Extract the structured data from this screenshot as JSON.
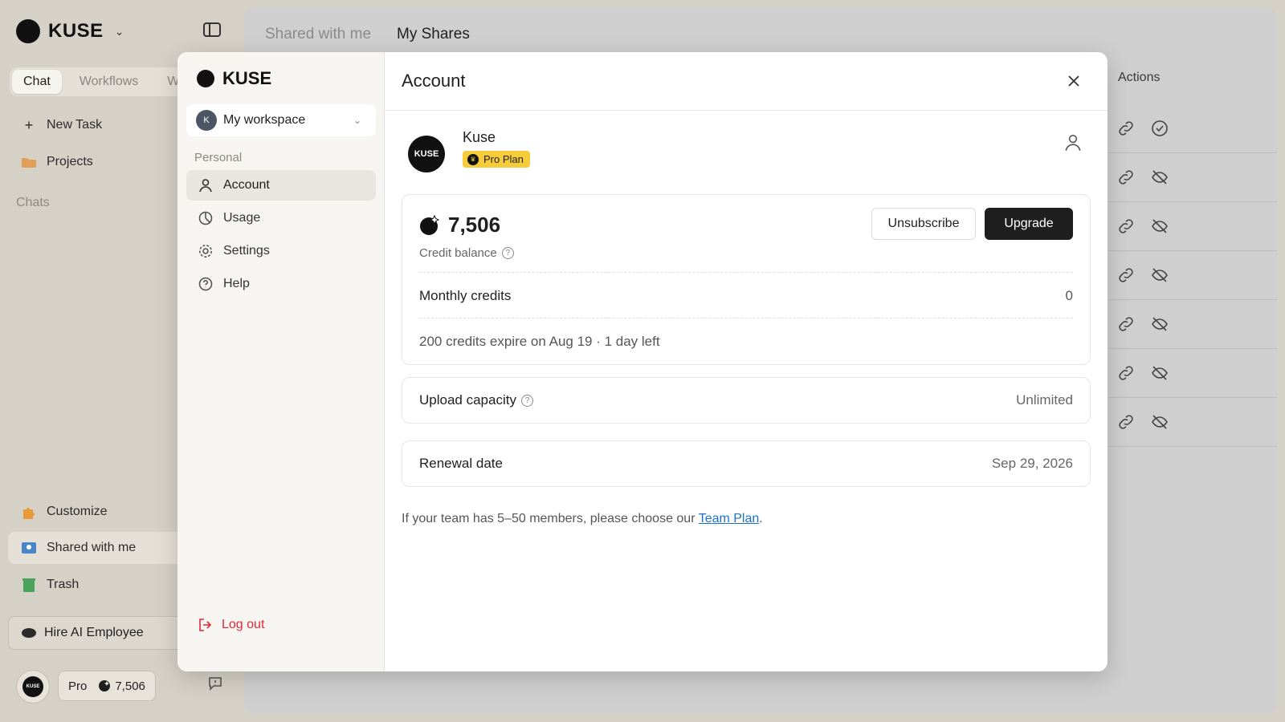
{
  "app": {
    "brand": "KUSE",
    "segment_tabs": [
      "Chat",
      "Workflows",
      "W"
    ],
    "nav": {
      "new_task": "New Task",
      "projects": "Projects",
      "chats_label": "Chats",
      "customize": "Customize",
      "shared_with_me": "Shared with me",
      "trash": "Trash",
      "hire": "Hire AI Employee"
    },
    "footer": {
      "avatar_text": "KUSE",
      "plan": "Pro",
      "credits": "7,506"
    },
    "main_tabs": [
      "Shared with me",
      "My Shares"
    ],
    "actions_header": "Actions",
    "action_rows": [
      {
        "first_icon": "link-icon",
        "second_icon": "check-circle-icon"
      },
      {
        "first_icon": "link-icon",
        "second_icon": "eye-off-icon"
      },
      {
        "first_icon": "link-icon",
        "second_icon": "eye-off-icon"
      },
      {
        "first_icon": "link-icon",
        "second_icon": "eye-off-icon"
      },
      {
        "first_icon": "link-icon",
        "second_icon": "eye-off-icon"
      },
      {
        "first_icon": "link-icon",
        "second_icon": "eye-off-icon"
      },
      {
        "first_icon": "link-icon",
        "second_icon": "eye-off-icon"
      }
    ]
  },
  "modal": {
    "brand": "KUSE",
    "workspace": {
      "initial": "K",
      "name": "My workspace"
    },
    "section_label": "Personal",
    "nav": [
      "Account",
      "Usage",
      "Settings",
      "Help"
    ],
    "logout": "Log out",
    "title": "Account",
    "profile": {
      "logo_text": "KUSE",
      "name": "Kuse",
      "plan_badge": "Pro Plan"
    },
    "credits": {
      "amount": "7,506",
      "label": "Credit balance",
      "unsubscribe": "Unsubscribe",
      "upgrade": "Upgrade",
      "monthly_label": "Monthly credits",
      "monthly_value": "0",
      "expiry_note": "200 credits expire on Aug 19 · 1 day left"
    },
    "upload": {
      "label": "Upload capacity",
      "value": "Unlimited"
    },
    "renewal": {
      "label": "Renewal date",
      "value": "Sep 29, 2026"
    },
    "team_note": {
      "prefix": "If your team has 5–50 members, please choose our ",
      "link": "Team Plan",
      "suffix": "."
    }
  },
  "colors": {
    "pro_badge": "#f6cc3b",
    "logout": "#e0283a",
    "link": "#1a73c8",
    "primary_button": "#1f1f1f"
  }
}
